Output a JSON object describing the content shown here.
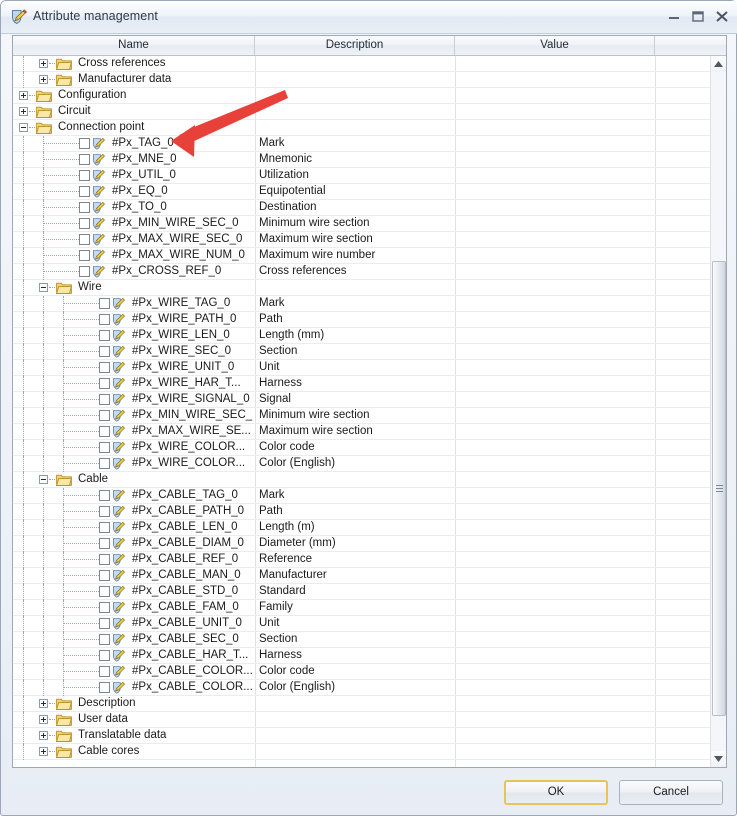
{
  "window": {
    "title": "Attribute management",
    "icon": "attribute-shield-pencil-icon",
    "minimize_label": "–",
    "maximize_label": "□",
    "close_label": "✕"
  },
  "grid": {
    "columns": [
      "Name",
      "Description",
      "Value",
      ""
    ],
    "rows": [
      {
        "level": 2,
        "type": "folder",
        "state": "collapsed",
        "name": "Cross references",
        "description": ""
      },
      {
        "level": 2,
        "type": "folder",
        "state": "collapsed",
        "name": "Manufacturer data",
        "description": ""
      },
      {
        "level": 1,
        "type": "folder",
        "state": "collapsed",
        "name": "Configuration",
        "description": ""
      },
      {
        "level": 1,
        "type": "folder",
        "state": "collapsed",
        "name": "Circuit",
        "description": ""
      },
      {
        "level": 1,
        "type": "folder",
        "state": "expanded",
        "name": "Connection point",
        "description": ""
      },
      {
        "level": 2,
        "type": "attr",
        "checked": false,
        "name": "#Px_TAG_0",
        "description": "Mark"
      },
      {
        "level": 2,
        "type": "attr",
        "checked": false,
        "name": "#Px_MNE_0",
        "description": "Mnemonic"
      },
      {
        "level": 2,
        "type": "attr",
        "checked": false,
        "name": "#Px_UTIL_0",
        "description": "Utilization"
      },
      {
        "level": 2,
        "type": "attr",
        "checked": false,
        "name": "#Px_EQ_0",
        "description": "Equipotential"
      },
      {
        "level": 2,
        "type": "attr",
        "checked": false,
        "name": "#Px_TO_0",
        "description": "Destination"
      },
      {
        "level": 2,
        "type": "attr",
        "checked": false,
        "name": "#Px_MIN_WIRE_SEC_0",
        "description": "Minimum wire section"
      },
      {
        "level": 2,
        "type": "attr",
        "checked": false,
        "name": "#Px_MAX_WIRE_SEC_0",
        "description": "Maximum wire section"
      },
      {
        "level": 2,
        "type": "attr",
        "checked": false,
        "name": "#Px_MAX_WIRE_NUM_0",
        "description": "Maximum wire number"
      },
      {
        "level": 2,
        "type": "attr",
        "checked": false,
        "name": "#Px_CROSS_REF_0",
        "description": "Cross references"
      },
      {
        "level": 2,
        "type": "folder",
        "state": "expanded",
        "name": "Wire",
        "description": ""
      },
      {
        "level": 3,
        "type": "attr",
        "checked": false,
        "name": "#Px_WIRE_TAG_0",
        "description": "Mark"
      },
      {
        "level": 3,
        "type": "attr",
        "checked": false,
        "name": "#Px_WIRE_PATH_0",
        "description": "Path"
      },
      {
        "level": 3,
        "type": "attr",
        "checked": false,
        "name": "#Px_WIRE_LEN_0",
        "description": "Length (mm)"
      },
      {
        "level": 3,
        "type": "attr",
        "checked": false,
        "name": "#Px_WIRE_SEC_0",
        "description": "Section"
      },
      {
        "level": 3,
        "type": "attr",
        "checked": false,
        "name": "#Px_WIRE_UNIT_0",
        "description": "Unit"
      },
      {
        "level": 3,
        "type": "attr",
        "checked": false,
        "name": "#Px_WIRE_HAR_T...",
        "description": "Harness"
      },
      {
        "level": 3,
        "type": "attr",
        "checked": false,
        "name": "#Px_WIRE_SIGNAL_0",
        "description": "Signal"
      },
      {
        "level": 3,
        "type": "attr",
        "checked": false,
        "name": "#Px_MIN_WIRE_SEC_",
        "description": "Minimum wire section"
      },
      {
        "level": 3,
        "type": "attr",
        "checked": false,
        "name": "#Px_MAX_WIRE_SE...",
        "description": "Maximum wire section"
      },
      {
        "level": 3,
        "type": "attr",
        "checked": false,
        "name": "#Px_WIRE_COLOR...",
        "description": "Color code"
      },
      {
        "level": 3,
        "type": "attr",
        "checked": false,
        "name": "#Px_WIRE_COLOR...",
        "description": "Color (English)"
      },
      {
        "level": 2,
        "type": "folder",
        "state": "expanded",
        "name": "Cable",
        "description": ""
      },
      {
        "level": 3,
        "type": "attr",
        "checked": false,
        "name": "#Px_CABLE_TAG_0",
        "description": "Mark"
      },
      {
        "level": 3,
        "type": "attr",
        "checked": false,
        "name": "#Px_CABLE_PATH_0",
        "description": "Path"
      },
      {
        "level": 3,
        "type": "attr",
        "checked": false,
        "name": "#Px_CABLE_LEN_0",
        "description": "Length (m)"
      },
      {
        "level": 3,
        "type": "attr",
        "checked": false,
        "name": "#Px_CABLE_DIAM_0",
        "description": "Diameter (mm)"
      },
      {
        "level": 3,
        "type": "attr",
        "checked": false,
        "name": "#Px_CABLE_REF_0",
        "description": "Reference"
      },
      {
        "level": 3,
        "type": "attr",
        "checked": false,
        "name": "#Px_CABLE_MAN_0",
        "description": "Manufacturer"
      },
      {
        "level": 3,
        "type": "attr",
        "checked": false,
        "name": "#Px_CABLE_STD_0",
        "description": "Standard"
      },
      {
        "level": 3,
        "type": "attr",
        "checked": false,
        "name": "#Px_CABLE_FAM_0",
        "description": "Family"
      },
      {
        "level": 3,
        "type": "attr",
        "checked": false,
        "name": "#Px_CABLE_UNIT_0",
        "description": "Unit"
      },
      {
        "level": 3,
        "type": "attr",
        "checked": false,
        "name": "#Px_CABLE_SEC_0",
        "description": "Section"
      },
      {
        "level": 3,
        "type": "attr",
        "checked": false,
        "name": "#Px_CABLE_HAR_T...",
        "description": "Harness"
      },
      {
        "level": 3,
        "type": "attr",
        "checked": false,
        "name": "#Px_CABLE_COLOR...",
        "description": "Color code"
      },
      {
        "level": 3,
        "type": "attr",
        "checked": false,
        "name": "#Px_CABLE_COLOR...",
        "description": "Color (English)"
      },
      {
        "level": 2,
        "type": "folder",
        "state": "collapsed",
        "name": "Description",
        "description": ""
      },
      {
        "level": 2,
        "type": "folder",
        "state": "collapsed",
        "name": "User data",
        "description": ""
      },
      {
        "level": 2,
        "type": "folder",
        "state": "collapsed",
        "name": "Translatable data",
        "description": ""
      },
      {
        "level": 2,
        "type": "folder",
        "state": "collapsed",
        "name": "Cable cores",
        "description": ""
      },
      {
        "level": 0,
        "type": "empty",
        "name": "",
        "description": ""
      }
    ]
  },
  "scrollbar": {
    "up_arrow": "scroll-up-arrow-icon",
    "down_arrow": "scroll-down-arrow-icon"
  },
  "annotation": {
    "shape": "red-arrow",
    "color": "#e8413a",
    "points_to": "Connection point"
  },
  "footer": {
    "ok_label": "OK",
    "cancel_label": "Cancel"
  },
  "colors": {
    "folder": "#f0c86a",
    "accent_focus": "#e8c35a",
    "annotation_red": "#e8413a"
  }
}
